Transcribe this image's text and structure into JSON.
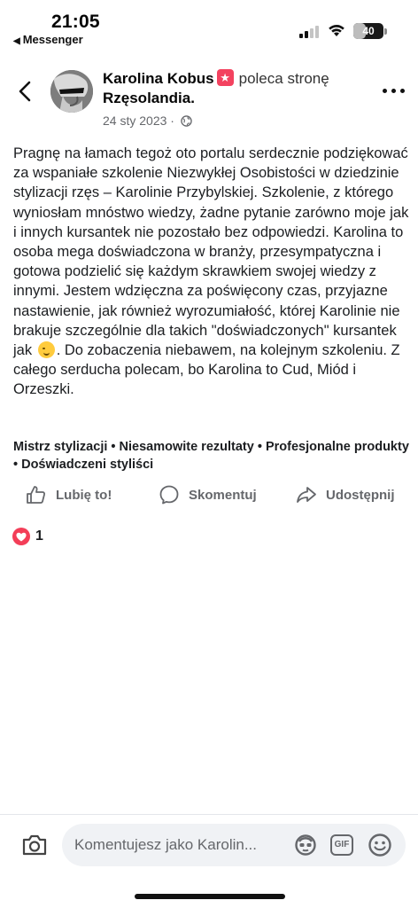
{
  "status_bar": {
    "time": "21:05",
    "back_app": "Messenger",
    "battery": "40",
    "battery_level": 0.4
  },
  "post": {
    "author": "Karolina Kobus",
    "verb": "poleca stronę",
    "page_name": "Rzęsolandia.",
    "date": "24 sty 2023",
    "privacy_icon": "globe-icon",
    "text_before_emoji": "Pragnę na łamach tegoż oto portalu serdecznie podziękować za wspaniałe szkolenie Niezwykłej Osobistości w dziedzinie stylizacji rzęs – Karolinie Przybylskiej. Szkolenie, z którego wyniosłam mnóstwo wiedzy, żadne pytanie zarówno moje jak i innych kursantek nie pozostało bez odpowiedzi. Karolina to osoba mega doświadczona w branży, przesympatyczna i gotowa podzielić się każdym skrawkiem swojej wiedzy z innymi. Jestem wdzięczna za poświęcony czas, przyjazne nastawienie, jak również wyrozumiałość, której Karolinie nie brakuje szczególnie dla takich \"doświadczonych\" kursantek jak",
    "text_after_emoji": ". Do zobaczenia niebawem, na kolejnym szkoleniu. Z całego serducha polecam, bo Karolina to Cud, Miód i Orzeszki.",
    "tags": "Mistrz stylizacji • Niesamowite rezultaty • Profesjonalne produkty • Doświadczeni styliści"
  },
  "actions": {
    "like": "Lubię to!",
    "comment": "Skomentuj",
    "share": "Udostępnij"
  },
  "reactions": {
    "count": "1",
    "type": "love"
  },
  "comment_bar": {
    "placeholder": "Komentujesz jako Karolin..."
  },
  "colors": {
    "secondary_text": "#65676b",
    "love_red": "#f33e58",
    "input_bg": "#f0f2f5",
    "badge_pink": "#f3425f"
  }
}
